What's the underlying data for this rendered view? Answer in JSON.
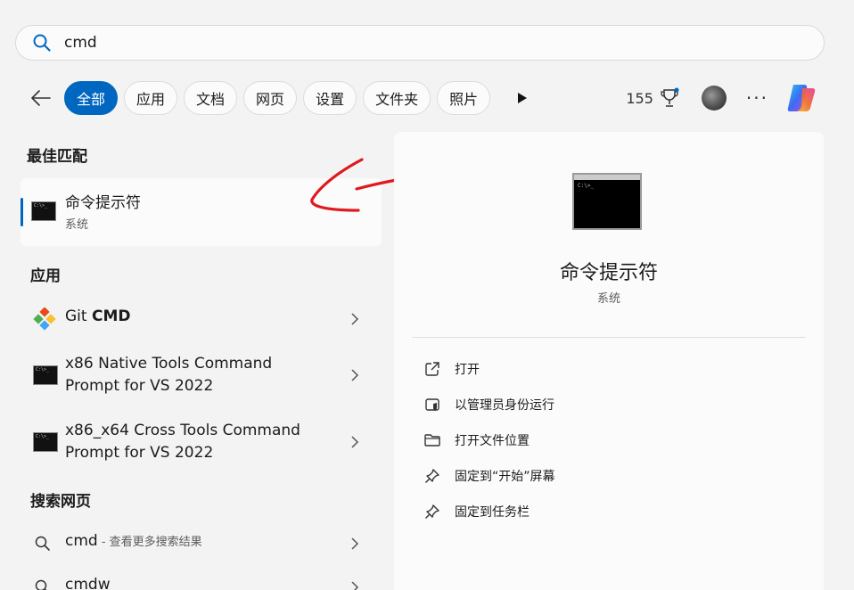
{
  "search": {
    "value": "cmd"
  },
  "tabs": [
    "全部",
    "应用",
    "文档",
    "网页",
    "设置",
    "文件夹",
    "照片"
  ],
  "toolbar": {
    "points": "155"
  },
  "best_match": {
    "heading": "最佳匹配",
    "title": "命令提示符",
    "subtitle": "系统"
  },
  "apps": {
    "heading": "应用",
    "items": [
      {
        "prefix": "Git ",
        "bold": "CMD",
        "line2": ""
      },
      {
        "prefix": "x86 Native Tools Command",
        "bold": "",
        "line2": "Prompt for VS 2022"
      },
      {
        "prefix": "x86_x64 Cross Tools Command",
        "bold": "",
        "line2": "Prompt for VS 2022"
      }
    ]
  },
  "web": {
    "heading": "搜索网页",
    "items": [
      {
        "query": "cmd",
        "suffix": " - 查看更多搜索结果"
      },
      {
        "query": "cmdw",
        "suffix": ""
      }
    ]
  },
  "detail": {
    "title": "命令提示符",
    "subtitle": "系统",
    "actions": [
      "打开",
      "以管理员身份运行",
      "打开文件位置",
      "固定到“开始”屏幕",
      "固定到任务栏"
    ]
  },
  "colors": {
    "accent": "#0067c0",
    "annotation": "#e0191e"
  }
}
